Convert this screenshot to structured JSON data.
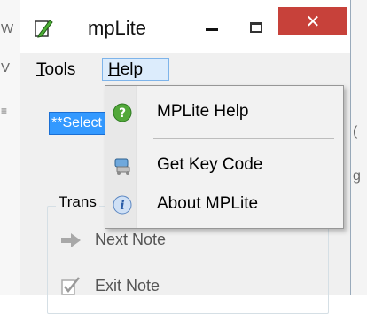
{
  "window": {
    "title": "mpLite",
    "close_glyph": "✕"
  },
  "menubar": {
    "tools": {
      "label": "Tools",
      "mnemonic": "T",
      "rest": "ools"
    },
    "help": {
      "label": "Help",
      "mnemonic": "H",
      "rest": "elp"
    }
  },
  "main": {
    "select_text": "**Select",
    "group_label": "Trans",
    "next_note": "Next Note",
    "exit_note": "Exit Note"
  },
  "help_menu": {
    "items": [
      {
        "label": "MPLite Help",
        "icon": "help-icon"
      },
      {
        "label": "Get Key Code",
        "icon": "key-code-icon"
      },
      {
        "label": "About MPLite",
        "icon": "info-icon"
      }
    ]
  },
  "background": {
    "left_fragments": [
      "W",
      "V",
      "≡"
    ],
    "right_fragments": [
      "(",
      "g"
    ]
  },
  "colors": {
    "close_button": "#c7413a",
    "menu_highlight": "#dcecfc",
    "selection": "#3399ff",
    "help_icon_green": "#52a83a"
  }
}
